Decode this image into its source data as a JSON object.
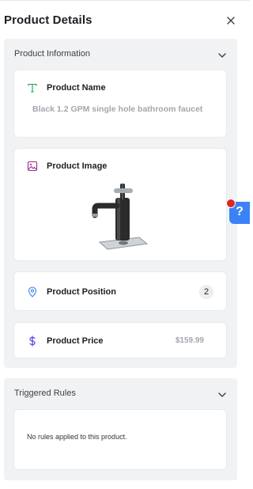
{
  "header": {
    "title": "Product Details"
  },
  "product_information": {
    "title": "Product Information",
    "name": {
      "label": "Product Name",
      "value": "Black 1.2 GPM single hole bathroom faucet",
      "icon": "text-type-icon"
    },
    "image": {
      "label": "Product Image",
      "icon": "image-icon",
      "photo": "faucet-photo"
    },
    "position": {
      "label": "Product Position",
      "value": "2",
      "icon": "location-pin-icon"
    },
    "price": {
      "label": "Product Price",
      "value": "$159.99",
      "icon": "dollar-icon"
    }
  },
  "triggered_rules": {
    "title": "Triggered Rules",
    "empty_message": "No rules applied to this product."
  },
  "help": {
    "label": "?"
  },
  "colors": {
    "accent_green": "#16a34a",
    "accent_purple": "#9d2a8a",
    "accent_blue": "#3b82f6",
    "accent_indigo": "#4f46e5",
    "notification_red": "#dc2626"
  }
}
